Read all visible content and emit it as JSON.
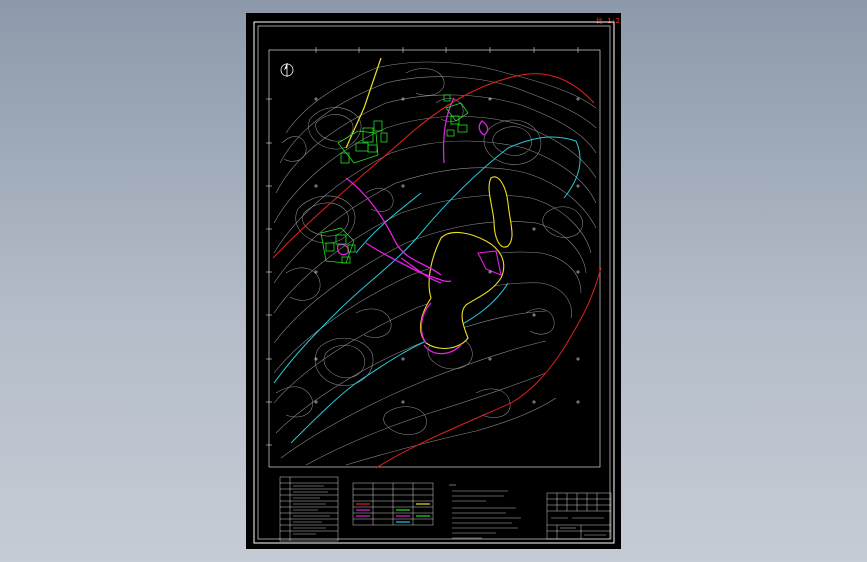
{
  "drawing": {
    "scale_label": "比 1:2",
    "colors": {
      "background": "#000000",
      "contour": "#9a9a9a",
      "boundary_red": "#e02020",
      "road_cyan": "#28c8d8",
      "pit_yellow": "#f0e020",
      "facility_magenta": "#e020e0",
      "building_green": "#20e020",
      "frame": "#ffffff"
    },
    "north_arrow": "north-arrow-icon"
  }
}
